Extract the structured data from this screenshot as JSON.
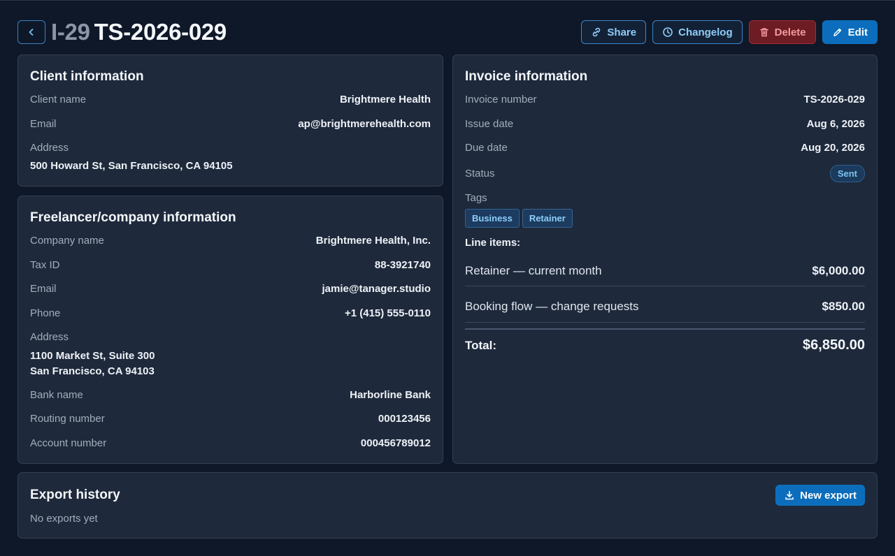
{
  "header": {
    "back_icon": "chevron-left-icon",
    "invoice_id": "I-29",
    "invoice_number": "TS-2026-029",
    "actions": {
      "share": "Share",
      "changelog": "Changelog",
      "delete": "Delete",
      "edit": "Edit"
    }
  },
  "client": {
    "title": "Client information",
    "name_label": "Client name",
    "name": "Brightmere Health",
    "email_label": "Email",
    "email": "ap@brightmerehealth.com",
    "address_label": "Address",
    "address": "500 Howard St, San Francisco, CA 94105"
  },
  "company": {
    "title": "Freelancer/company information",
    "name_label": "Company name",
    "name": "Brightmere Health, Inc.",
    "tax_label": "Tax ID",
    "tax": "88-3921740",
    "email_label": "Email",
    "email": "jamie@tanager.studio",
    "phone_label": "Phone",
    "phone": "+1 (415) 555-0110",
    "address_label": "Address",
    "address_line1": "1100 Market St, Suite 300",
    "address_line2": "San Francisco, CA 94103",
    "bank_label": "Bank name",
    "bank": "Harborline Bank",
    "routing_label": "Routing number",
    "routing": "000123456",
    "account_label": "Account number",
    "account": "000456789012"
  },
  "invoice": {
    "title": "Invoice information",
    "number_label": "Invoice number",
    "number": "TS-2026-029",
    "issue_label": "Issue date",
    "issue": "Aug 6, 2026",
    "due_label": "Due date",
    "due": "Aug 20, 2026",
    "status_label": "Status",
    "status": "Sent",
    "tags_label": "Tags",
    "tags": [
      "Business",
      "Retainer"
    ],
    "line_items_label": "Line items:",
    "line_items": [
      {
        "name": "Retainer — current month",
        "amount": "$6,000.00"
      },
      {
        "name": "Booking flow — change requests",
        "amount": "$850.00"
      }
    ],
    "total_label": "Total:",
    "total": "$6,850.00"
  },
  "exports": {
    "title": "Export history",
    "empty": "No exports yet",
    "new_export": "New export"
  },
  "colors": {
    "background": "#0f1828",
    "card": "#1e293b",
    "primary": "#0b6dbb",
    "danger": "#6d1c23"
  }
}
